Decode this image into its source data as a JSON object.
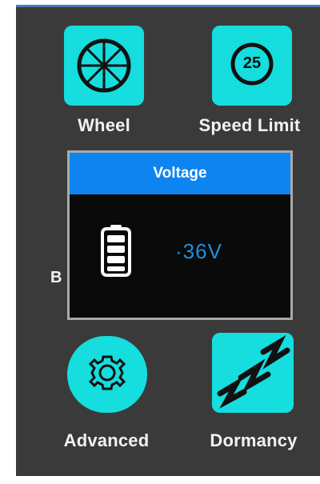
{
  "menu": {
    "wheel_label": "Wheel",
    "speed_limit_label": "Speed Limit",
    "speed_limit_value": "25",
    "advanced_label": "Advanced",
    "dormancy_label": "Dormancy",
    "partially_hidden_label": "B"
  },
  "dialog": {
    "title": "Voltage",
    "value": "·36V",
    "battery_icon": "battery-full-icon"
  },
  "colors": {
    "screen_bg": "#3b3a3a",
    "tile_cyan": "#16ddde",
    "dialog_header": "#0d84f0",
    "dialog_bg": "#0a0a0a",
    "value_blue": "#1e8fe0"
  }
}
